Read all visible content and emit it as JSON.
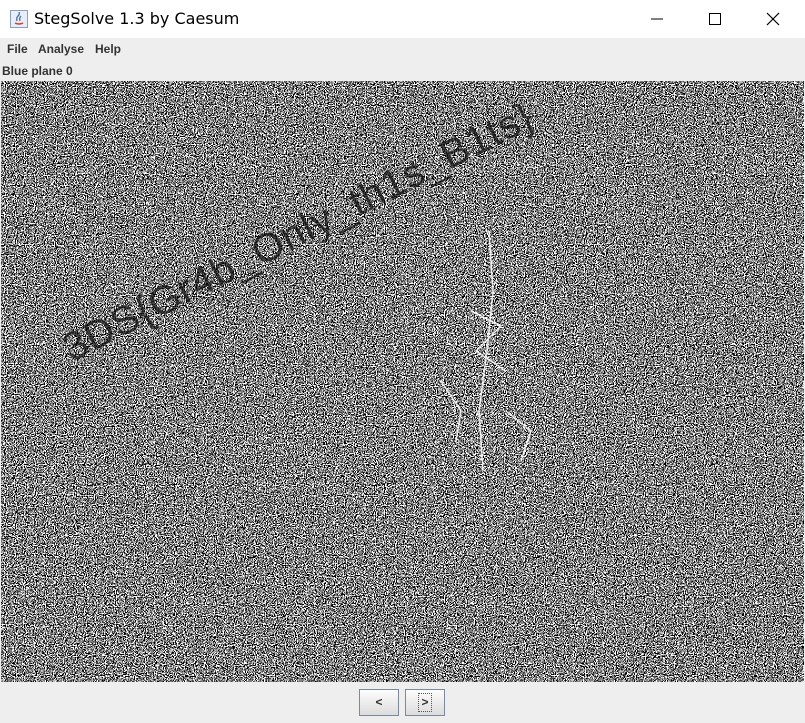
{
  "window": {
    "title": "StegSolve 1.3 by Caesum"
  },
  "menu": {
    "items": [
      "File",
      "Analyse",
      "Help"
    ]
  },
  "view": {
    "plane_label": "Blue plane 0",
    "hidden_text": "3DS{Gr4b_Only_th1s_B1ts}"
  },
  "nav": {
    "prev_label": "<",
    "next_label": ">"
  },
  "colors": {
    "noise_dark": "#000000",
    "noise_light": "#ffffff",
    "chrome": "#eeeeee"
  },
  "icons": [
    "java-app-icon",
    "minimize-icon",
    "maximize-icon",
    "close-icon"
  ]
}
